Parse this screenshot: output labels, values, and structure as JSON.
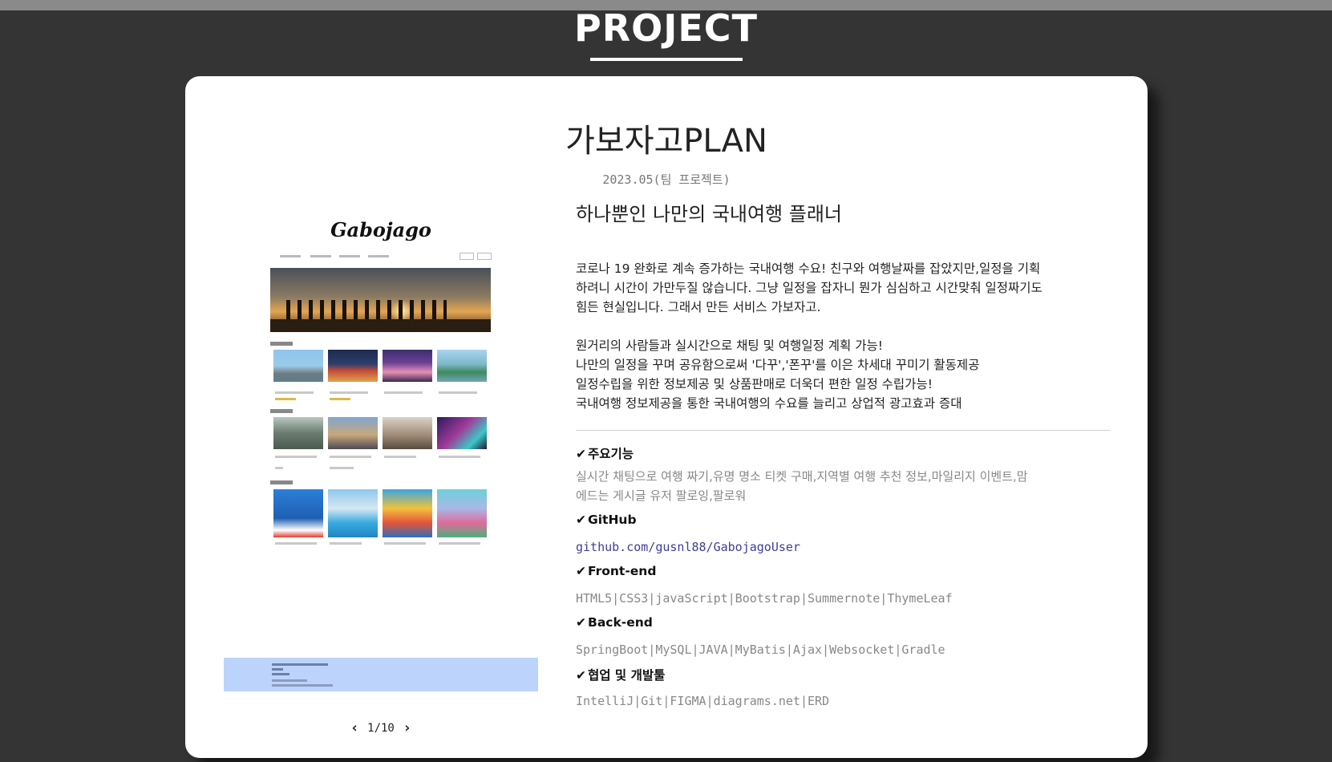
{
  "header": {
    "section_title": "PROJECT"
  },
  "project": {
    "title": "가보자고PLAN",
    "date": "2023.05(팀 프로젝트)",
    "subtitle": "하나뿐인 나만의 국내여행 플래너",
    "description": [
      "코로나 19 완화로 계속 증가하는 국내여행 수요! 친구와 여행날짜를 잡았지만,일정을 기획",
      "하려니 시간이 가만두질 않습니다. 그냥 일정을 잡자니 뭔가 심심하고 시간맞춰 일정짜기도",
      "힘든 현실입니다. 그래서 만든 서비스 가보자고.",
      "원거리의 사람들과 실시간으로 채팅 및 여행일정 계획 가능!",
      "나만의 일정을 꾸며 공유함으로써 '다꾸','폰꾸'를 이은 차세대 꾸미기 활동제공",
      "일정수립을 위한 정보제공 및 상품판매로 더욱더 편한 일정 수립가능!",
      "국내여행 정보제공을 통한 국내여행의 수요를 늘리고 상업적 광고효과 증대"
    ],
    "features": {
      "main_label": "주요기능",
      "main_value_1": "실시간 채팅으로 여행 짜기,유명 명소 티켓 구매,지역별 여행 추천 정보,마일리지 이벤트,맘",
      "main_value_2": "에드는 게시글 유저 팔로잉,팔로워",
      "github_label": "GitHub",
      "github_value": "github.com/gusnl88/GabojagoUser",
      "frontend_label": "Front-end",
      "frontend_value": "HTML5|CSS3|javaScript|Bootstrap|Summernote|ThymeLeaf",
      "backend_label": "Back-end",
      "backend_value": "SpringBoot|MySQL|JAVA|MyBatis|Ajax|Websocket|Gradle",
      "tools_label": "협업 및 개발툴",
      "tools_value": "IntelliJ|Git|FIGMA|diagrams.net|ERD"
    }
  },
  "mockup": {
    "logo": "Gabojago"
  },
  "pager": {
    "current": "1/10",
    "prev_icon": "chevron-left-icon",
    "next_icon": "chevron-right-icon"
  },
  "colors": {
    "background": "#343434",
    "card": "#ffffff",
    "banner": "#bcd3fb",
    "link": "#3b3f9a"
  }
}
